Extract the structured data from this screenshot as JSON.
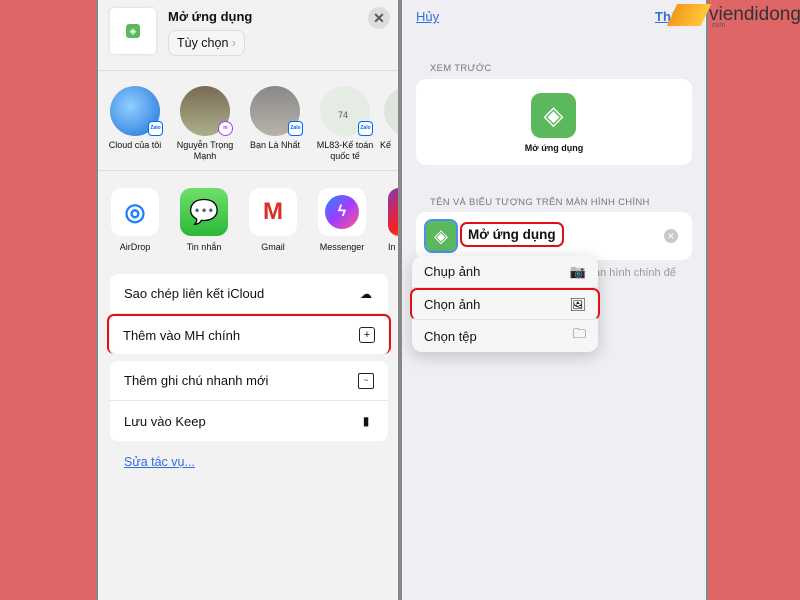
{
  "share": {
    "title": "Mở ứng dụng",
    "options": "Tùy chọn",
    "close": "✕",
    "contacts": [
      {
        "name": "Cloud của tôi",
        "badge": "Zalo"
      },
      {
        "name": "Nguyễn Trọng Mạnh",
        "badge": "Messenger"
      },
      {
        "name": "Bạn Là Nhất",
        "badge": "Zalo"
      },
      {
        "name": "ML83-Kế toán quốc tế",
        "badge": "Zalo",
        "count": "74"
      },
      {
        "name": "Kế"
      }
    ],
    "apps": [
      {
        "name": "AirDrop"
      },
      {
        "name": "Tin nhắn"
      },
      {
        "name": "Gmail"
      },
      {
        "name": "Messenger"
      },
      {
        "name": "In"
      }
    ],
    "actions1": [
      {
        "label": "Sao chép liên kết iCloud",
        "icon": "link-cloud-icon"
      },
      {
        "label": "Thêm vào MH chính",
        "icon": "plus-square-icon"
      }
    ],
    "actions2": [
      {
        "label": "Thêm ghi chú nhanh mới",
        "icon": "note-icon"
      },
      {
        "label": "Lưu vào Keep",
        "icon": "bookmark-icon"
      }
    ],
    "edit": "Sửa tác vụ..."
  },
  "add": {
    "cancel": "Hủy",
    "add": "Thêm",
    "preview_caption": "XEM TRƯỚC",
    "preview_name": "Mở ứng dụng",
    "name_caption": "TÊN VÀ BIỂU TƯỢNG TRÊN MÀN HÌNH CHÍNH",
    "name_value": "Mở ứng dụng",
    "hint": "àn hình chính để",
    "menu": [
      {
        "label": "Chụp ảnh",
        "icon": "camera-icon"
      },
      {
        "label": "Chọn ảnh",
        "icon": "photos-icon"
      },
      {
        "label": "Chọn tệp",
        "icon": "folder-icon"
      }
    ]
  },
  "watermark": {
    "brand": "viendidong",
    "sub": ".com"
  },
  "colors": {
    "background": "#df6666",
    "highlight": "#e0101a",
    "link": "#2f6fdc",
    "shortcut_green": "#5bb85d"
  }
}
